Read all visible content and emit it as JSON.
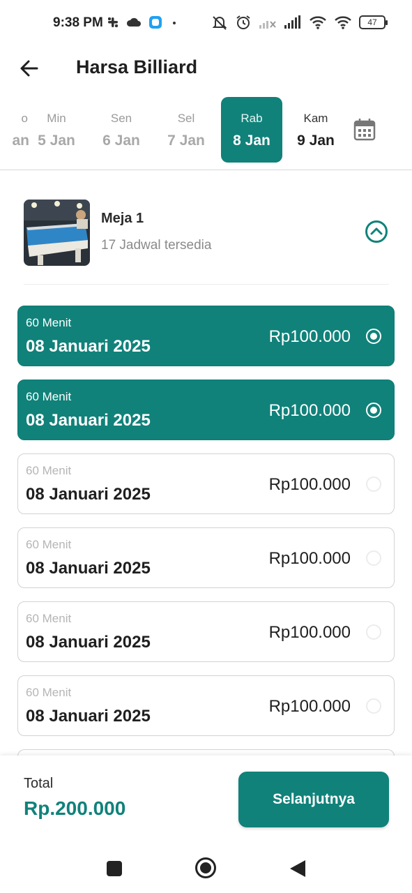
{
  "status_bar": {
    "time": "9:38 PM",
    "battery": "47",
    "left_icons": [
      "slack-icon",
      "cloud-icon",
      "app-notification-icon",
      "dot-icon"
    ],
    "right_icons": [
      "mute-icon",
      "alarm-icon",
      "signal-icon",
      "signal-icon",
      "wifi-icon",
      "wifi-icon",
      "battery-icon"
    ]
  },
  "app_bar": {
    "title": "Harsa Billiard",
    "back_icon": "arrow-left-icon"
  },
  "date_strip": {
    "partial_prev": {
      "dow": "o",
      "dm": "an"
    },
    "items": [
      {
        "dow": "Min",
        "dm": "5 Jan",
        "state": "past"
      },
      {
        "dow": "Sen",
        "dm": "6 Jan",
        "state": "past"
      },
      {
        "dow": "Sel",
        "dm": "7 Jan",
        "state": "past"
      },
      {
        "dow": "Rab",
        "dm": "8 Jan",
        "state": "selected"
      },
      {
        "dow": "Kam",
        "dm": "9 Jan",
        "state": "future"
      }
    ],
    "calendar_icon": "calendar-icon"
  },
  "table": {
    "name": "Meja 1",
    "schedules": "17 Jadwal tersedia",
    "toggle_icon": "chevron-up-circle-icon"
  },
  "slots": [
    {
      "duration": "60 Menit",
      "date": "08 Januari 2025",
      "price": "Rp100.000",
      "selected": true
    },
    {
      "duration": "60 Menit",
      "date": "08 Januari 2025",
      "price": "Rp100.000",
      "selected": true
    },
    {
      "duration": "60 Menit",
      "date": "08 Januari 2025",
      "price": "Rp100.000",
      "selected": false
    },
    {
      "duration": "60 Menit",
      "date": "08 Januari 2025",
      "price": "Rp100.000",
      "selected": false
    },
    {
      "duration": "60 Menit",
      "date": "08 Januari 2025",
      "price": "Rp100.000",
      "selected": false
    },
    {
      "duration": "60 Menit",
      "date": "08 Januari 2025",
      "price": "Rp100.000",
      "selected": false
    }
  ],
  "footer": {
    "total_label": "Total",
    "total_value": "Rp.200.000",
    "next_label": "Selanjutnya"
  },
  "colors": {
    "primary": "#10827a",
    "muted_text": "#a8a8a8"
  },
  "nav_bar": {
    "icons": [
      "recents-square-icon",
      "home-circle-icon",
      "back-triangle-icon"
    ]
  }
}
